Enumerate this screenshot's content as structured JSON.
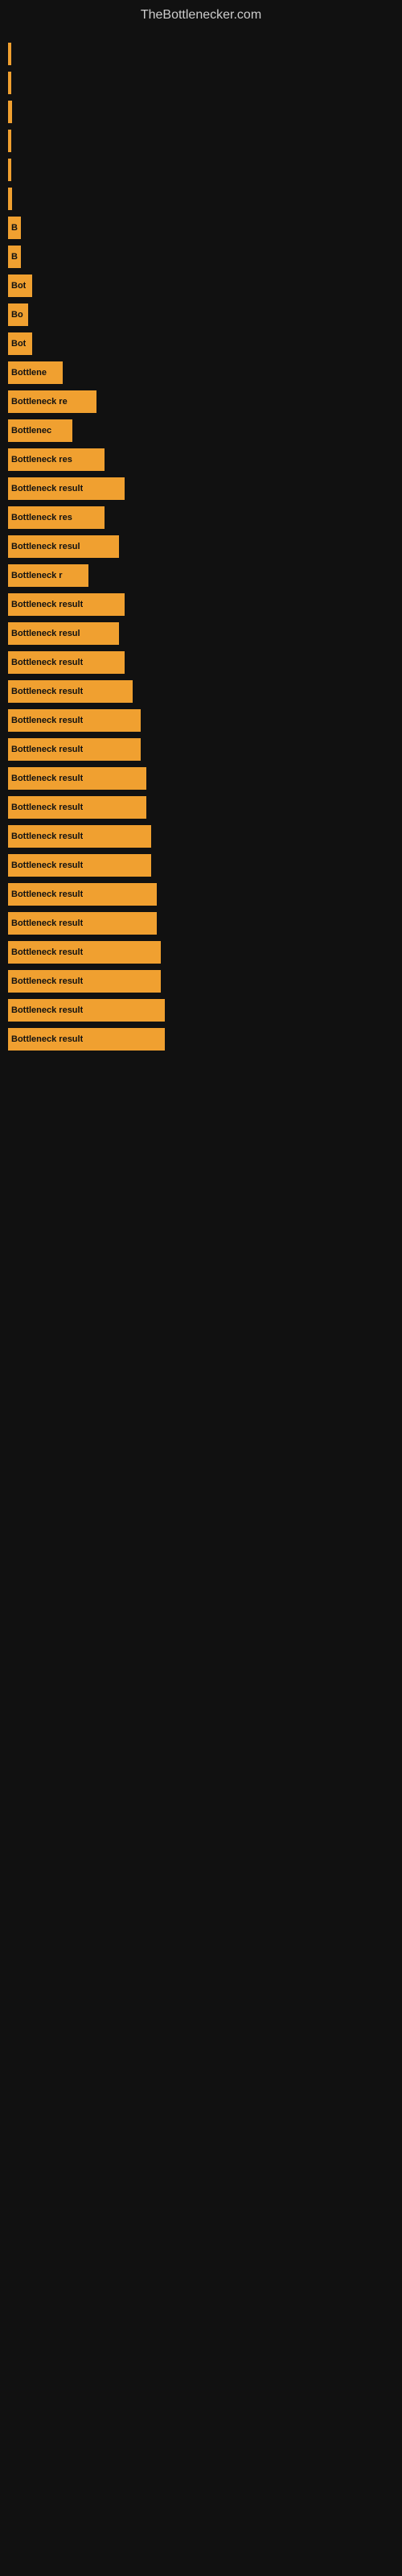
{
  "site": {
    "title": "TheBottlenecker.com"
  },
  "bars": [
    {
      "id": 1,
      "label": "",
      "width": 4
    },
    {
      "id": 2,
      "label": "",
      "width": 4
    },
    {
      "id": 3,
      "label": "",
      "width": 5
    },
    {
      "id": 4,
      "label": "",
      "width": 4
    },
    {
      "id": 5,
      "label": "",
      "width": 4
    },
    {
      "id": 6,
      "label": "",
      "width": 5
    },
    {
      "id": 7,
      "label": "B",
      "width": 16
    },
    {
      "id": 8,
      "label": "B",
      "width": 16
    },
    {
      "id": 9,
      "label": "Bot",
      "width": 30
    },
    {
      "id": 10,
      "label": "Bo",
      "width": 25
    },
    {
      "id": 11,
      "label": "Bot",
      "width": 30
    },
    {
      "id": 12,
      "label": "Bottlene",
      "width": 68
    },
    {
      "id": 13,
      "label": "Bottleneck re",
      "width": 110
    },
    {
      "id": 14,
      "label": "Bottlenec",
      "width": 80
    },
    {
      "id": 15,
      "label": "Bottleneck res",
      "width": 120
    },
    {
      "id": 16,
      "label": "Bottleneck result",
      "width": 145
    },
    {
      "id": 17,
      "label": "Bottleneck res",
      "width": 120
    },
    {
      "id": 18,
      "label": "Bottleneck resul",
      "width": 138
    },
    {
      "id": 19,
      "label": "Bottleneck r",
      "width": 100
    },
    {
      "id": 20,
      "label": "Bottleneck result",
      "width": 145
    },
    {
      "id": 21,
      "label": "Bottleneck resul",
      "width": 138
    },
    {
      "id": 22,
      "label": "Bottleneck result",
      "width": 145
    },
    {
      "id": 23,
      "label": "Bottleneck result",
      "width": 155
    },
    {
      "id": 24,
      "label": "Bottleneck result",
      "width": 165
    },
    {
      "id": 25,
      "label": "Bottleneck result",
      "width": 165
    },
    {
      "id": 26,
      "label": "Bottleneck result",
      "width": 172
    },
    {
      "id": 27,
      "label": "Bottleneck result",
      "width": 172
    },
    {
      "id": 28,
      "label": "Bottleneck result",
      "width": 178
    },
    {
      "id": 29,
      "label": "Bottleneck result",
      "width": 178
    },
    {
      "id": 30,
      "label": "Bottleneck result",
      "width": 185
    },
    {
      "id": 31,
      "label": "Bottleneck result",
      "width": 185
    },
    {
      "id": 32,
      "label": "Bottleneck result",
      "width": 190
    },
    {
      "id": 33,
      "label": "Bottleneck result",
      "width": 190
    },
    {
      "id": 34,
      "label": "Bottleneck result",
      "width": 195
    },
    {
      "id": 35,
      "label": "Bottleneck result",
      "width": 195
    }
  ]
}
